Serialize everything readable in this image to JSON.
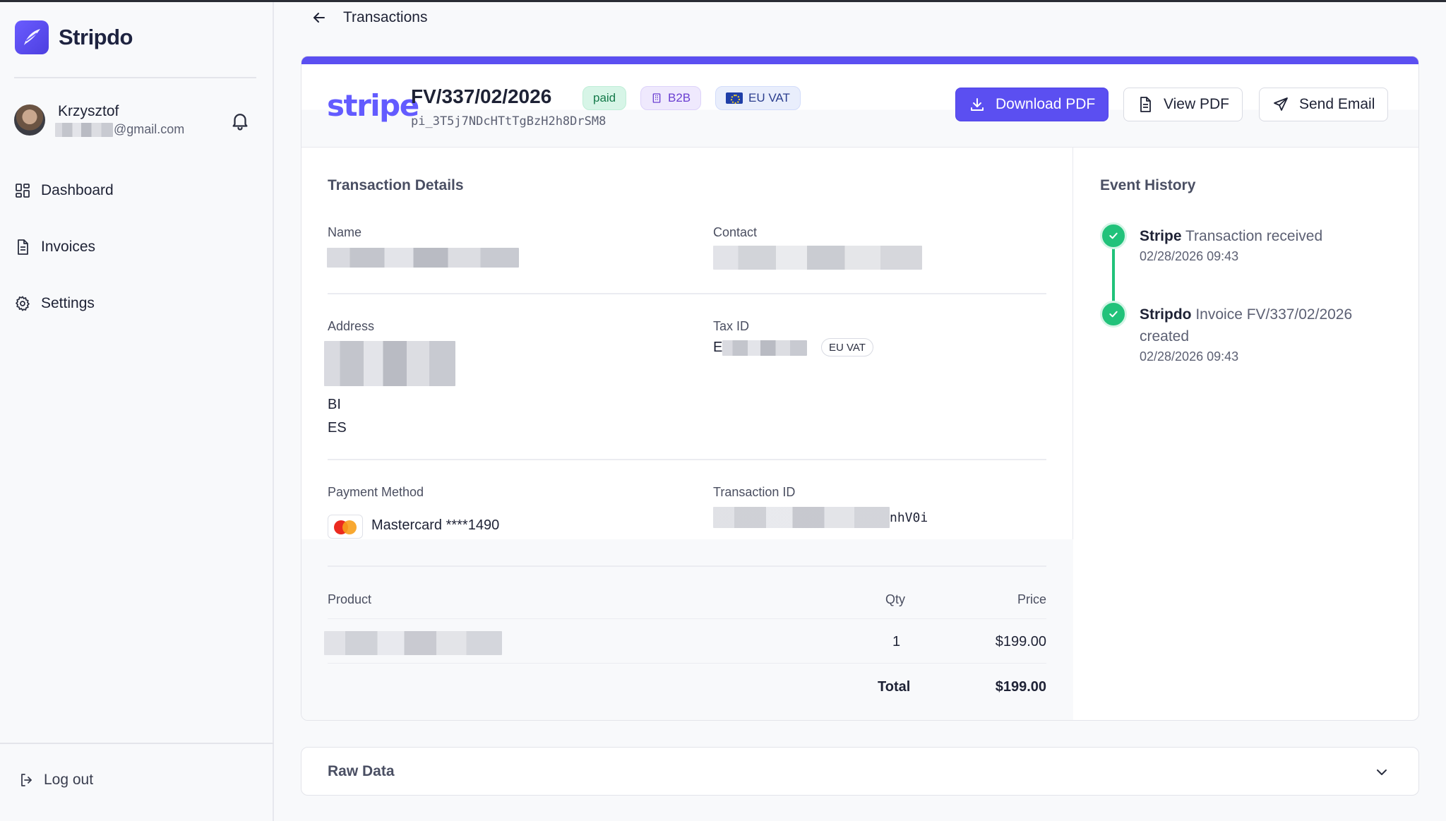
{
  "brand": {
    "name": "Stripdo"
  },
  "user": {
    "name": "Krzysztof",
    "email_suffix": "@gmail.com"
  },
  "nav": [
    {
      "label": "Dashboard",
      "icon": "dashboard-icon"
    },
    {
      "label": "Invoices",
      "icon": "document-icon"
    },
    {
      "label": "Settings",
      "icon": "gear-icon"
    }
  ],
  "logout_label": "Log out",
  "topbar": {
    "title": "Transactions"
  },
  "invoice": {
    "provider": "stripe",
    "number": "FV/337/02/2026",
    "payment_intent": "pi_3T5j7NDcHTtTgBzH2h8DrSM8",
    "badges": {
      "paid": "paid",
      "b2b": "B2B",
      "vat": "EU VAT"
    },
    "actions": {
      "download": "Download PDF",
      "view": "View PDF",
      "send": "Send Email"
    }
  },
  "details": {
    "title": "Transaction Details",
    "name_label": "Name",
    "contact_label": "Contact",
    "address_label": "Address",
    "address_lines": [
      "BI",
      "ES"
    ],
    "tax_id_label": "Tax ID",
    "tax_id_prefix": "E",
    "tax_chip": "EU VAT",
    "payment_method_label": "Payment Method",
    "payment_method_value": "Mastercard ****1490",
    "transaction_id_label": "Transaction ID",
    "transaction_id_suffix": "nhV0i"
  },
  "products": {
    "headers": {
      "product": "Product",
      "qty": "Qty",
      "price": "Price"
    },
    "rows": [
      {
        "qty": "1",
        "price": "$199.00"
      }
    ],
    "total_label": "Total",
    "total_value": "$199.00"
  },
  "history": {
    "title": "Event History",
    "events": [
      {
        "source": "Stripe",
        "text": "Transaction received",
        "time": "02/28/2026 09:43"
      },
      {
        "source": "Stripdo",
        "text": "Invoice FV/337/02/2026 created",
        "time": "02/28/2026 09:43"
      }
    ]
  },
  "raw": {
    "title": "Raw Data"
  },
  "colors": {
    "accent": "#5b4ff1",
    "success": "#21c27a",
    "stripe": "#635bff"
  }
}
